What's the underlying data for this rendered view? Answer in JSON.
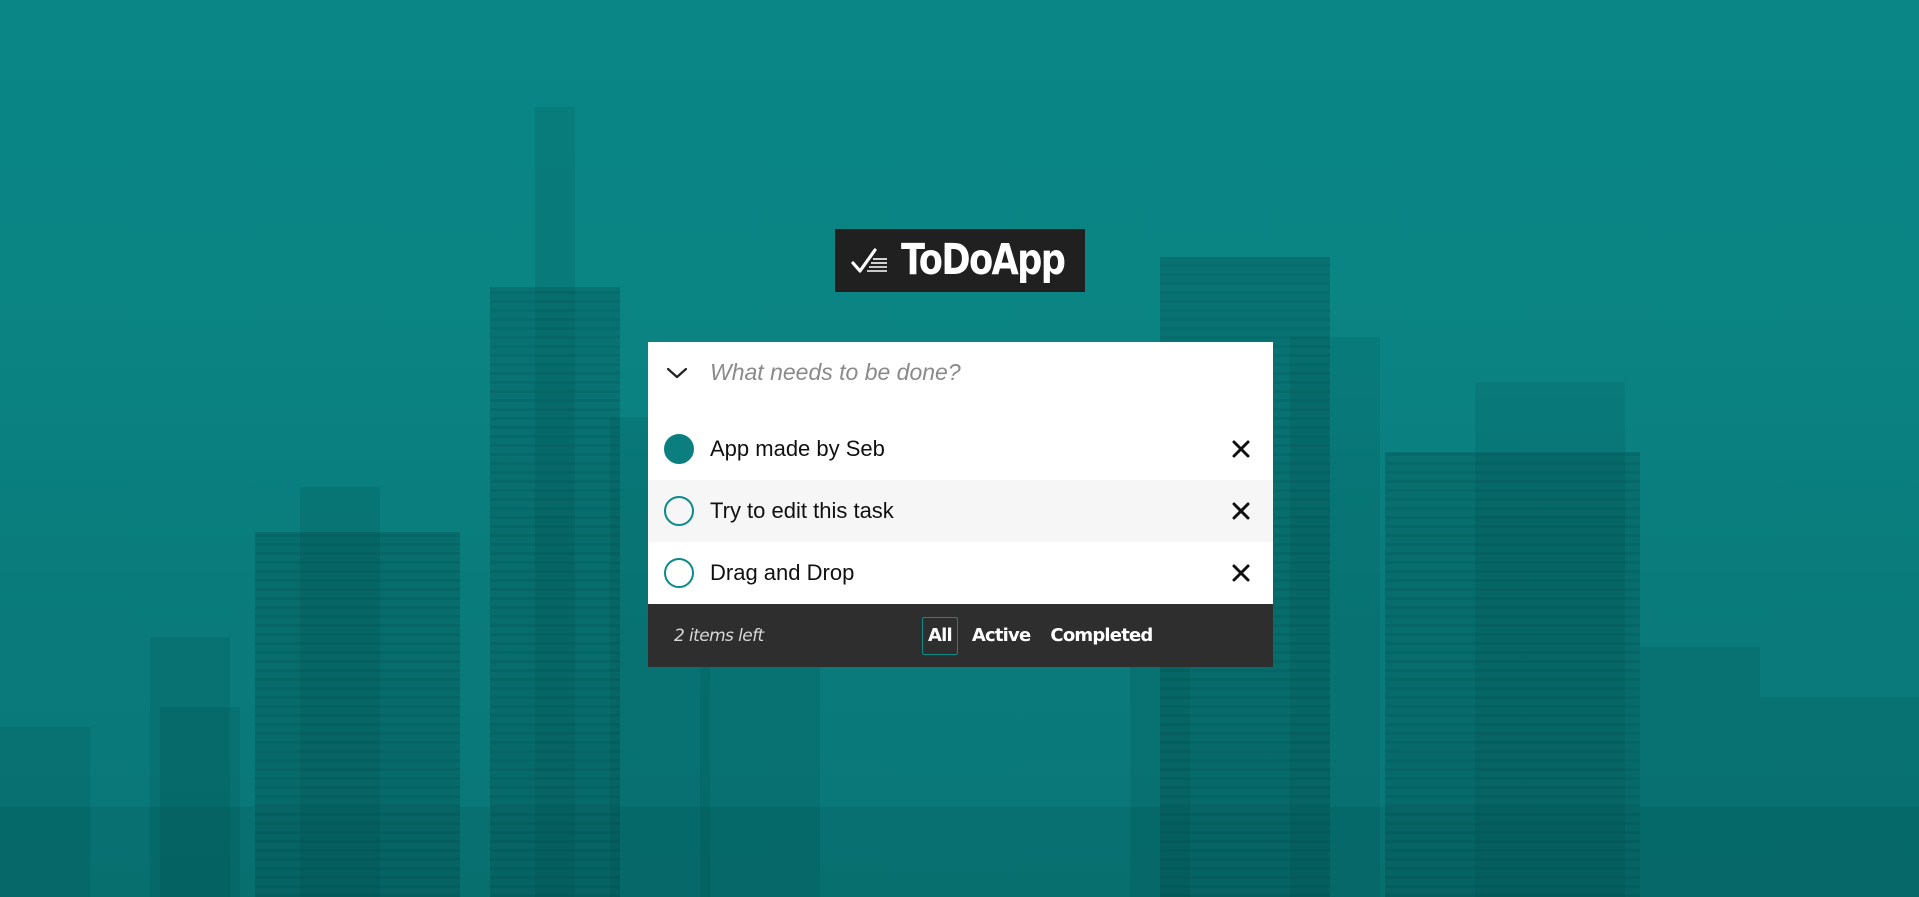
{
  "app": {
    "title": "ToDoApp",
    "logo_icon": "checklist-icon",
    "accent_color": "#0b8484",
    "dark_color": "#2e2e2e"
  },
  "new_todo": {
    "toggle_icon": "chevron-down-icon",
    "placeholder": "What needs to be done?",
    "value": ""
  },
  "todos": [
    {
      "label": "App made by Seb",
      "completed": true,
      "delete_icon": "close-icon"
    },
    {
      "label": "Try to edit this task",
      "completed": false,
      "delete_icon": "close-icon"
    },
    {
      "label": "Drag and Drop",
      "completed": false,
      "delete_icon": "close-icon"
    }
  ],
  "footer": {
    "items_left": "2 items left",
    "filters": [
      {
        "label": "All",
        "selected": true
      },
      {
        "label": "Active",
        "selected": false
      },
      {
        "label": "Completed",
        "selected": false
      }
    ]
  }
}
